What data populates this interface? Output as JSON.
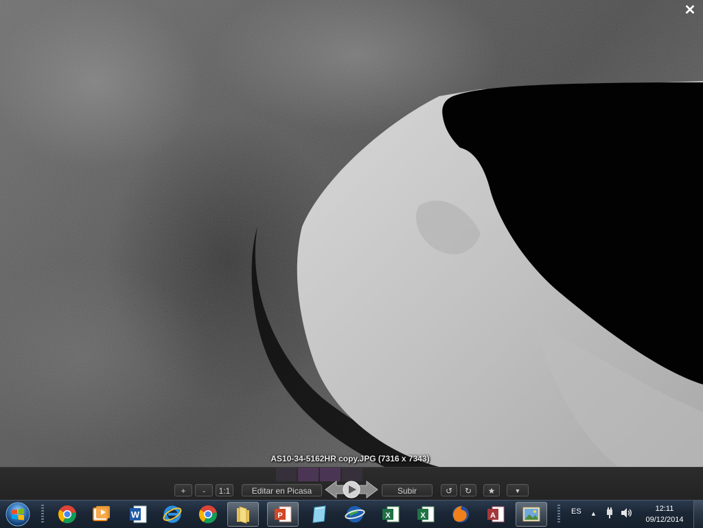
{
  "viewer": {
    "caption": "AS10-34-5162HR copy.JPG (7316 x 7343)",
    "close_glyph": "✕"
  },
  "toolbar": {
    "zoom_in": "+",
    "zoom_out": "-",
    "actual_size": "1:1",
    "edit_label": "Editar en Picasa",
    "upload_label": "Subir",
    "rotate_left_glyph": "↺",
    "rotate_right_glyph": "↻",
    "star_glyph": "★",
    "menu_glyph": "▼"
  },
  "taskbar": {
    "apps": [
      {
        "name": "chrome-icon"
      },
      {
        "name": "media-player-icon"
      },
      {
        "name": "word-icon"
      },
      {
        "name": "internet-explorer-icon"
      },
      {
        "name": "chrome-icon"
      },
      {
        "name": "explorer-folder-icon"
      },
      {
        "name": "powerpoint-icon"
      },
      {
        "name": "notes-icon"
      },
      {
        "name": "google-earth-icon"
      },
      {
        "name": "excel-icon"
      },
      {
        "name": "excel-icon"
      },
      {
        "name": "firefox-icon"
      },
      {
        "name": "access-icon"
      },
      {
        "name": "picasa-viewer-icon"
      }
    ],
    "language": "ES",
    "time": "12:11",
    "date": "09/12/2014"
  },
  "colors": {
    "taskbar": "#1b2736",
    "toolbar": "#2a2a2a"
  }
}
